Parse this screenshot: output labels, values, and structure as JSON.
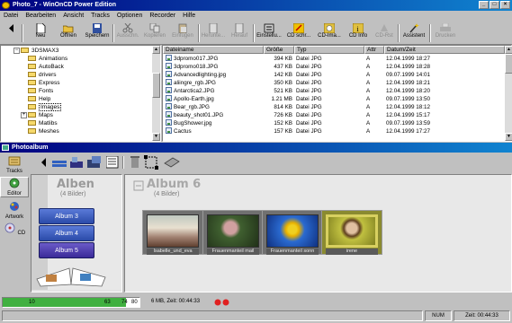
{
  "window": {
    "title": "Photo_7 - WinOnCD Power Edition",
    "controls": [
      "_",
      "□",
      "×"
    ]
  },
  "menu": [
    "Datei",
    "Bearbeiten",
    "Ansicht",
    "Tracks",
    "Optionen",
    "Recorder",
    "Hilfe"
  ],
  "toolbar": {
    "items": [
      {
        "label": "Neu",
        "icon": "new-doc-icon",
        "enabled": true
      },
      {
        "label": "Öffnen",
        "icon": "open-folder-icon",
        "enabled": true
      },
      {
        "label": "Speichern",
        "icon": "save-disk-icon",
        "enabled": true
      },
      {
        "label": "Ausschn.",
        "icon": "cut-icon",
        "enabled": false
      },
      {
        "label": "Kopieren",
        "icon": "copy-icon",
        "enabled": false
      },
      {
        "label": "Einfügen",
        "icon": "paste-icon",
        "enabled": false
      },
      {
        "label": "Herunte...",
        "icon": "move-down-icon",
        "enabled": false
      },
      {
        "label": "Herauf",
        "icon": "move-up-icon",
        "enabled": false
      },
      {
        "label": "Einstellu...",
        "icon": "settings-icon",
        "enabled": true
      },
      {
        "label": "CD schr...",
        "icon": "cd-write-icon",
        "enabled": true
      },
      {
        "label": "CD-Ima...",
        "icon": "cd-image-icon",
        "enabled": true
      },
      {
        "label": "CD Info",
        "icon": "cd-info-icon",
        "enabled": true
      },
      {
        "label": "CD-Rst",
        "icon": "cd-reset-icon",
        "enabled": false
      },
      {
        "label": "Assistent",
        "icon": "wizard-icon",
        "enabled": true
      },
      {
        "label": "Drucken",
        "icon": "print-icon",
        "enabled": false
      }
    ]
  },
  "tree": {
    "items": [
      {
        "label": "3DSMAX3",
        "expandable": true
      },
      {
        "label": "Animations",
        "expandable": false
      },
      {
        "label": "AutoBack",
        "expandable": false
      },
      {
        "label": "drivers",
        "expandable": false
      },
      {
        "label": "Express",
        "expandable": false
      },
      {
        "label": "Fonts",
        "expandable": false
      },
      {
        "label": "Help",
        "expandable": false
      },
      {
        "label": "Images",
        "expandable": false,
        "selected": true
      },
      {
        "label": "Maps",
        "expandable": true
      },
      {
        "label": "Matlibs",
        "expandable": false
      },
      {
        "label": "Meshes",
        "expandable": false
      }
    ]
  },
  "filelist": {
    "columns": [
      "Dateiname",
      "Größe",
      "Typ",
      "Attr",
      "Datum/Zeit"
    ],
    "rows": [
      [
        "3dpromo017.JPG",
        "394 KB",
        "Datei JPG",
        "A",
        "12.04.1999 18:27"
      ],
      [
        "3dpromo018.JPG",
        "437 KB",
        "Datei JPG",
        "A",
        "12.04.1999 18:28"
      ],
      [
        "Advancedlighting.jpg",
        "142 KB",
        "Datei JPG",
        "A",
        "09.07.1999 14:01"
      ],
      [
        "aliingre_rgb.JPG",
        "350 KB",
        "Datei JPG",
        "A",
        "12.04.1999 18:21"
      ],
      [
        "Antarctica2.JPG",
        "521 KB",
        "Datei JPG",
        "A",
        "12.04.1999 18:20"
      ],
      [
        "Apollo-Earth.jpg",
        "1.21 MB",
        "Datei JPG",
        "A",
        "09.07.1999 13:50"
      ],
      [
        "Bear_rgb.JPG",
        "814 KB",
        "Datei JPG",
        "A",
        "12.04.1999 18:12"
      ],
      [
        "beauty_shot01.JPG",
        "726 KB",
        "Datei JPG",
        "A",
        "12.04.1999 15:17"
      ],
      [
        "BugShower.jpg",
        "152 KB",
        "Datei JPG",
        "A",
        "09.07.1999 13:59"
      ],
      [
        "Cactus",
        "157 KB",
        "Datei JPG",
        "A",
        "12.04.1999 17:27"
      ]
    ]
  },
  "photoalbum": {
    "title": "Photoalbum",
    "nav": [
      {
        "label": "Tracks",
        "icon": "tracks-icon"
      },
      {
        "label": "Editor",
        "icon": "editor-icon"
      },
      {
        "label": "Artwork",
        "icon": "artwork-icon"
      },
      {
        "label": "CD",
        "icon": "cd-icon"
      }
    ],
    "left": {
      "heading": "Alben",
      "subheading": "(4 Bilder)",
      "books": [
        "Album 3",
        "Album 4",
        "Album 5"
      ]
    },
    "right": {
      "heading": "Album 6",
      "subheading": "(4 Bilder)",
      "photos": [
        {
          "caption": "Isabelle_und_eva"
        },
        {
          "caption": "Frauenmanteil mail"
        },
        {
          "caption": "Frauenmanteil sonn"
        },
        {
          "caption": "irene"
        }
      ]
    }
  },
  "status": {
    "progress_left": "10",
    "progress_ticks": [
      "63",
      "74",
      "80"
    ],
    "progress_fraction": 0.9,
    "size_info": "6 MB, Zeit: 00:44:33",
    "num": "NUM",
    "time": "Zeit: 00:44:33"
  }
}
